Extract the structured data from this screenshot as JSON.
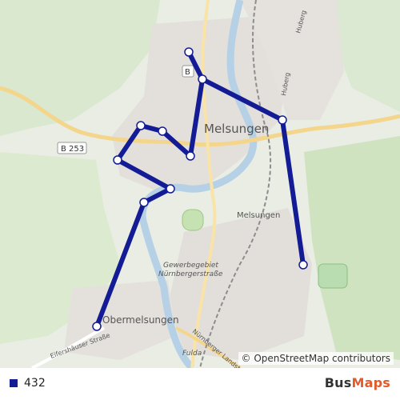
{
  "map": {
    "route_color": "#141c95",
    "labels": {
      "melsungen_big": "Melsungen",
      "melsungen_station": "Melsungen",
      "obermelsungen": "Obermelsungen",
      "gewerbe1": "Gewerbegebiet",
      "gewerbe2": "Nürnbergerstraße",
      "b253": "B 253",
      "b_shield": "B",
      "huberg1": "Huberg",
      "huberg2": "Huberg",
      "eifershauser": "Eifershäuser Straße",
      "nuernberger_road": "Nürnberger Landstr.",
      "fulda": "Fulda"
    }
  },
  "attribution": "© OpenStreetMap contributors",
  "legend": {
    "route_number": "432",
    "route_color": "#141c95"
  },
  "brand": {
    "part1": "Bus",
    "part2": "Maps"
  }
}
